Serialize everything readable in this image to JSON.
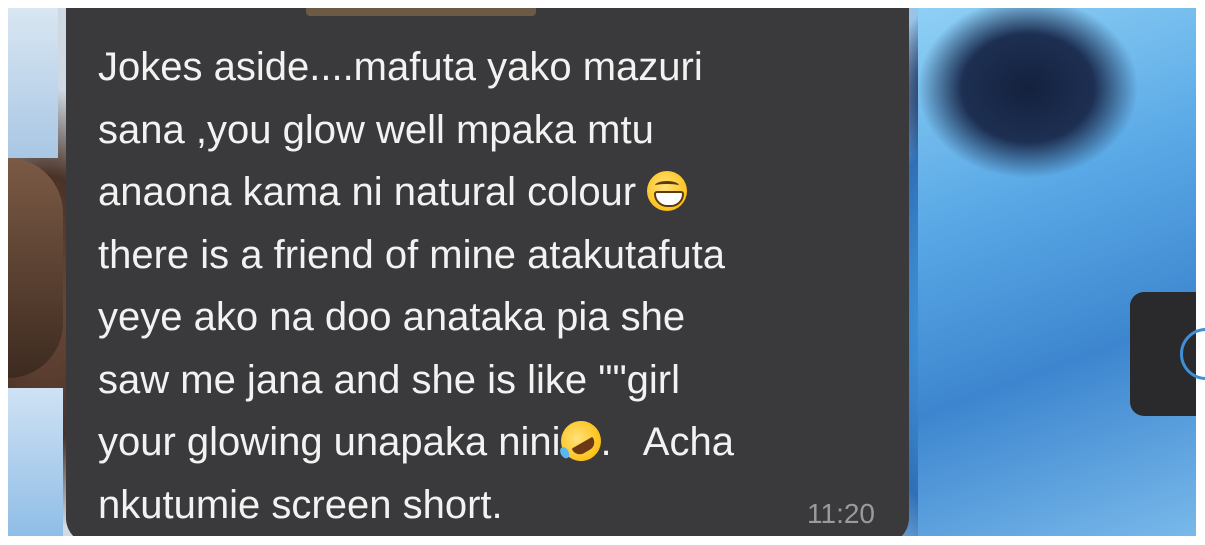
{
  "message": {
    "lines": [
      "Jokes aside....mafuta yako mazuri",
      "sana ,you glow well mpaka mtu",
      "anaona kama ni natural colour ",
      "there is a friend of mine atakutafuta",
      "yeye ako na doo anataka pia she",
      "saw me jana and she is like \"\"girl",
      "your glowing unapaka nini",
      ".   Acha",
      "nkutumie screen short."
    ],
    "time": "11:20",
    "emoji": [
      "grinning-face-with-smiling-eyes",
      "rolling-on-the-floor-laughing"
    ]
  },
  "colors": {
    "bubble": "#3a3a3c",
    "text": "#f2f2f2",
    "timestamp": "#9a9a9e",
    "accent": "#3f8fd6"
  },
  "icons": {
    "side_button": "circle-icon"
  }
}
